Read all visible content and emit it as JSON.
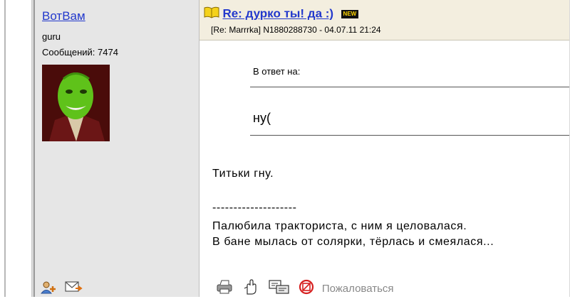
{
  "author": {
    "name": "ВотВам",
    "rank": "guru",
    "posts_count": "Сообщений: 7474"
  },
  "post": {
    "title": "Re: дурко ты! да :)",
    "badge": "NEW",
    "meta": "[Re: Marrrka]  N1880288730 - 04.07.11 21:24",
    "quote_label": "В ответ на:",
    "quote_text": "ну(",
    "body_line1": "Титьки гну.",
    "separator": "--------------------",
    "body_line2": "Палюбила тракториста, с ним я целовалася.",
    "body_line3": "В бане мылась от солярки, тёрлась и смеялася..."
  },
  "actions": {
    "complain_label": "Пожаловаться"
  },
  "colors": {
    "link": "#2238cc",
    "header_bg": "#f3eedf",
    "author_bg": "#e6e6e6",
    "complain": "#888888",
    "complain_icon": "#d62020"
  }
}
